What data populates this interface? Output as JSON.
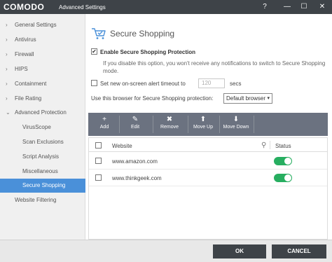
{
  "titlebar": {
    "logo": "COMODO",
    "title": "Advanced Settings",
    "help": "?",
    "minimize": "—",
    "maximize": "☐",
    "close": "✕"
  },
  "sidebar": {
    "items": [
      {
        "label": "General Settings",
        "chevron": "›"
      },
      {
        "label": "Antivirus",
        "chevron": "›"
      },
      {
        "label": "Firewall",
        "chevron": "›"
      },
      {
        "label": "HIPS",
        "chevron": "›"
      },
      {
        "label": "Containment",
        "chevron": "›"
      },
      {
        "label": "File Rating",
        "chevron": "›"
      },
      {
        "label": "Advanced Protection",
        "chevron": "⌄"
      },
      {
        "label": "VirusScope"
      },
      {
        "label": "Scan Exclusions"
      },
      {
        "label": "Script Analysis"
      },
      {
        "label": "Miscellaneous"
      },
      {
        "label": "Secure Shopping"
      },
      {
        "label": "Website Filtering"
      }
    ]
  },
  "content": {
    "title": "Secure Shopping",
    "enable_label": "Enable Secure Shopping Protection",
    "enable_checked": "✔",
    "enable_note_line1": "If you disable this option, you won't receive any notifications to switch to Secure Shopping",
    "enable_note_line2": "mode.",
    "timeout_label": "Set new on-screen alert timeout to",
    "timeout_value": "120",
    "timeout_unit": "secs",
    "browser_label": "Use this browser for Secure Shopping protection:",
    "browser_value": "Default browser",
    "browser_arrow": "▾"
  },
  "toolbar": {
    "add": {
      "icon": "+",
      "label": "Add"
    },
    "edit": {
      "icon": "✎",
      "label": "Edit"
    },
    "remove": {
      "icon": "✖",
      "label": "Remove"
    },
    "move_up": {
      "icon": "⬆",
      "label": "Move Up"
    },
    "move_down": {
      "icon": "⬇",
      "label": "Move Down"
    }
  },
  "table": {
    "col_website": "Website",
    "col_status": "Status",
    "search_icon": "⚲",
    "rows": [
      {
        "website": "www.amazon.com",
        "enabled": true
      },
      {
        "website": "www.thinkgeek.com",
        "enabled": true
      }
    ]
  },
  "footer": {
    "ok": "OK",
    "cancel": "CANCEL"
  },
  "colors": {
    "titlebar": "#3e4348",
    "active_nav": "#4a90d9",
    "toolbar": "#6b7280",
    "toggle_on": "#27ae60"
  }
}
